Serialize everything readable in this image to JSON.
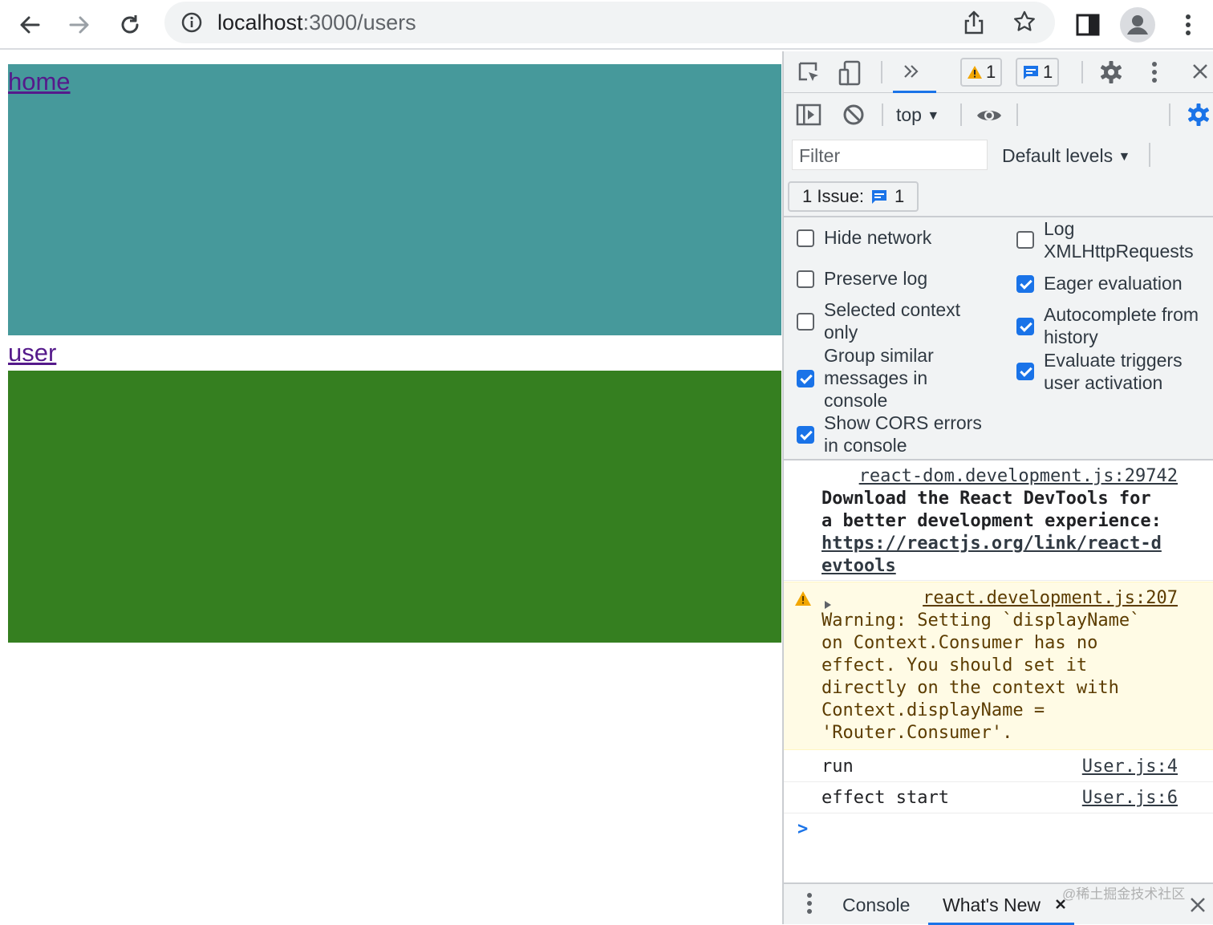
{
  "browser": {
    "url_host": "localhost",
    "url_path": ":3000/users"
  },
  "page": {
    "links": [
      {
        "label": "home"
      },
      {
        "label": "user"
      }
    ],
    "colors": {
      "home_block": "#46999b",
      "user_block": "#357f20",
      "link": "#551a8b"
    }
  },
  "devtools": {
    "toolbar": {
      "warning_count": "1",
      "info_count": "1"
    },
    "console_toolbar": {
      "context": "top",
      "filter_placeholder": "Filter",
      "levels": "Default levels"
    },
    "issues": {
      "label": "1 Issue:",
      "count": "1"
    },
    "settings": {
      "left": [
        {
          "label": "Hide network",
          "checked": false
        },
        {
          "label": "Preserve log",
          "checked": false
        },
        {
          "label_lines": [
            "Selected context",
            "only"
          ],
          "checked": false
        },
        {
          "label_lines": [
            "Group similar",
            "messages in",
            "console"
          ],
          "checked": true
        },
        {
          "label_lines": [
            "Show CORS errors",
            "in console"
          ],
          "checked": true
        }
      ],
      "right": [
        {
          "label_lines": [
            "Log",
            "XMLHttpRequests"
          ],
          "checked": false
        },
        {
          "label": "Eager evaluation",
          "checked": true
        },
        {
          "label_lines": [
            "Autocomplete from",
            "history"
          ],
          "checked": true
        },
        {
          "label_lines": [
            "Evaluate triggers",
            "user activation"
          ],
          "checked": true
        }
      ]
    },
    "console": {
      "messages": [
        {
          "source": "react-dom.development.js:29742",
          "lines": [
            "Download the React DevTools for",
            "a better development experience:"
          ],
          "link_lines": [
            "https://reactjs.org/link/react-d",
            "evtools"
          ]
        },
        {
          "level": "warning",
          "source": "react.development.js:207",
          "lines": [
            "Warning: Setting `displayName`",
            "on Context.Consumer has no",
            "effect. You should set it",
            "directly on the context with",
            "Context.displayName =",
            "'Router.Consumer'."
          ]
        },
        {
          "text": "run",
          "source": "User.js:4"
        },
        {
          "text": "effect start",
          "source": "User.js:6"
        }
      ],
      "prompt": ">"
    },
    "drawer": {
      "tabs": [
        "Console",
        "What's New"
      ]
    },
    "watermark": "@稀土掘金技术社区"
  }
}
